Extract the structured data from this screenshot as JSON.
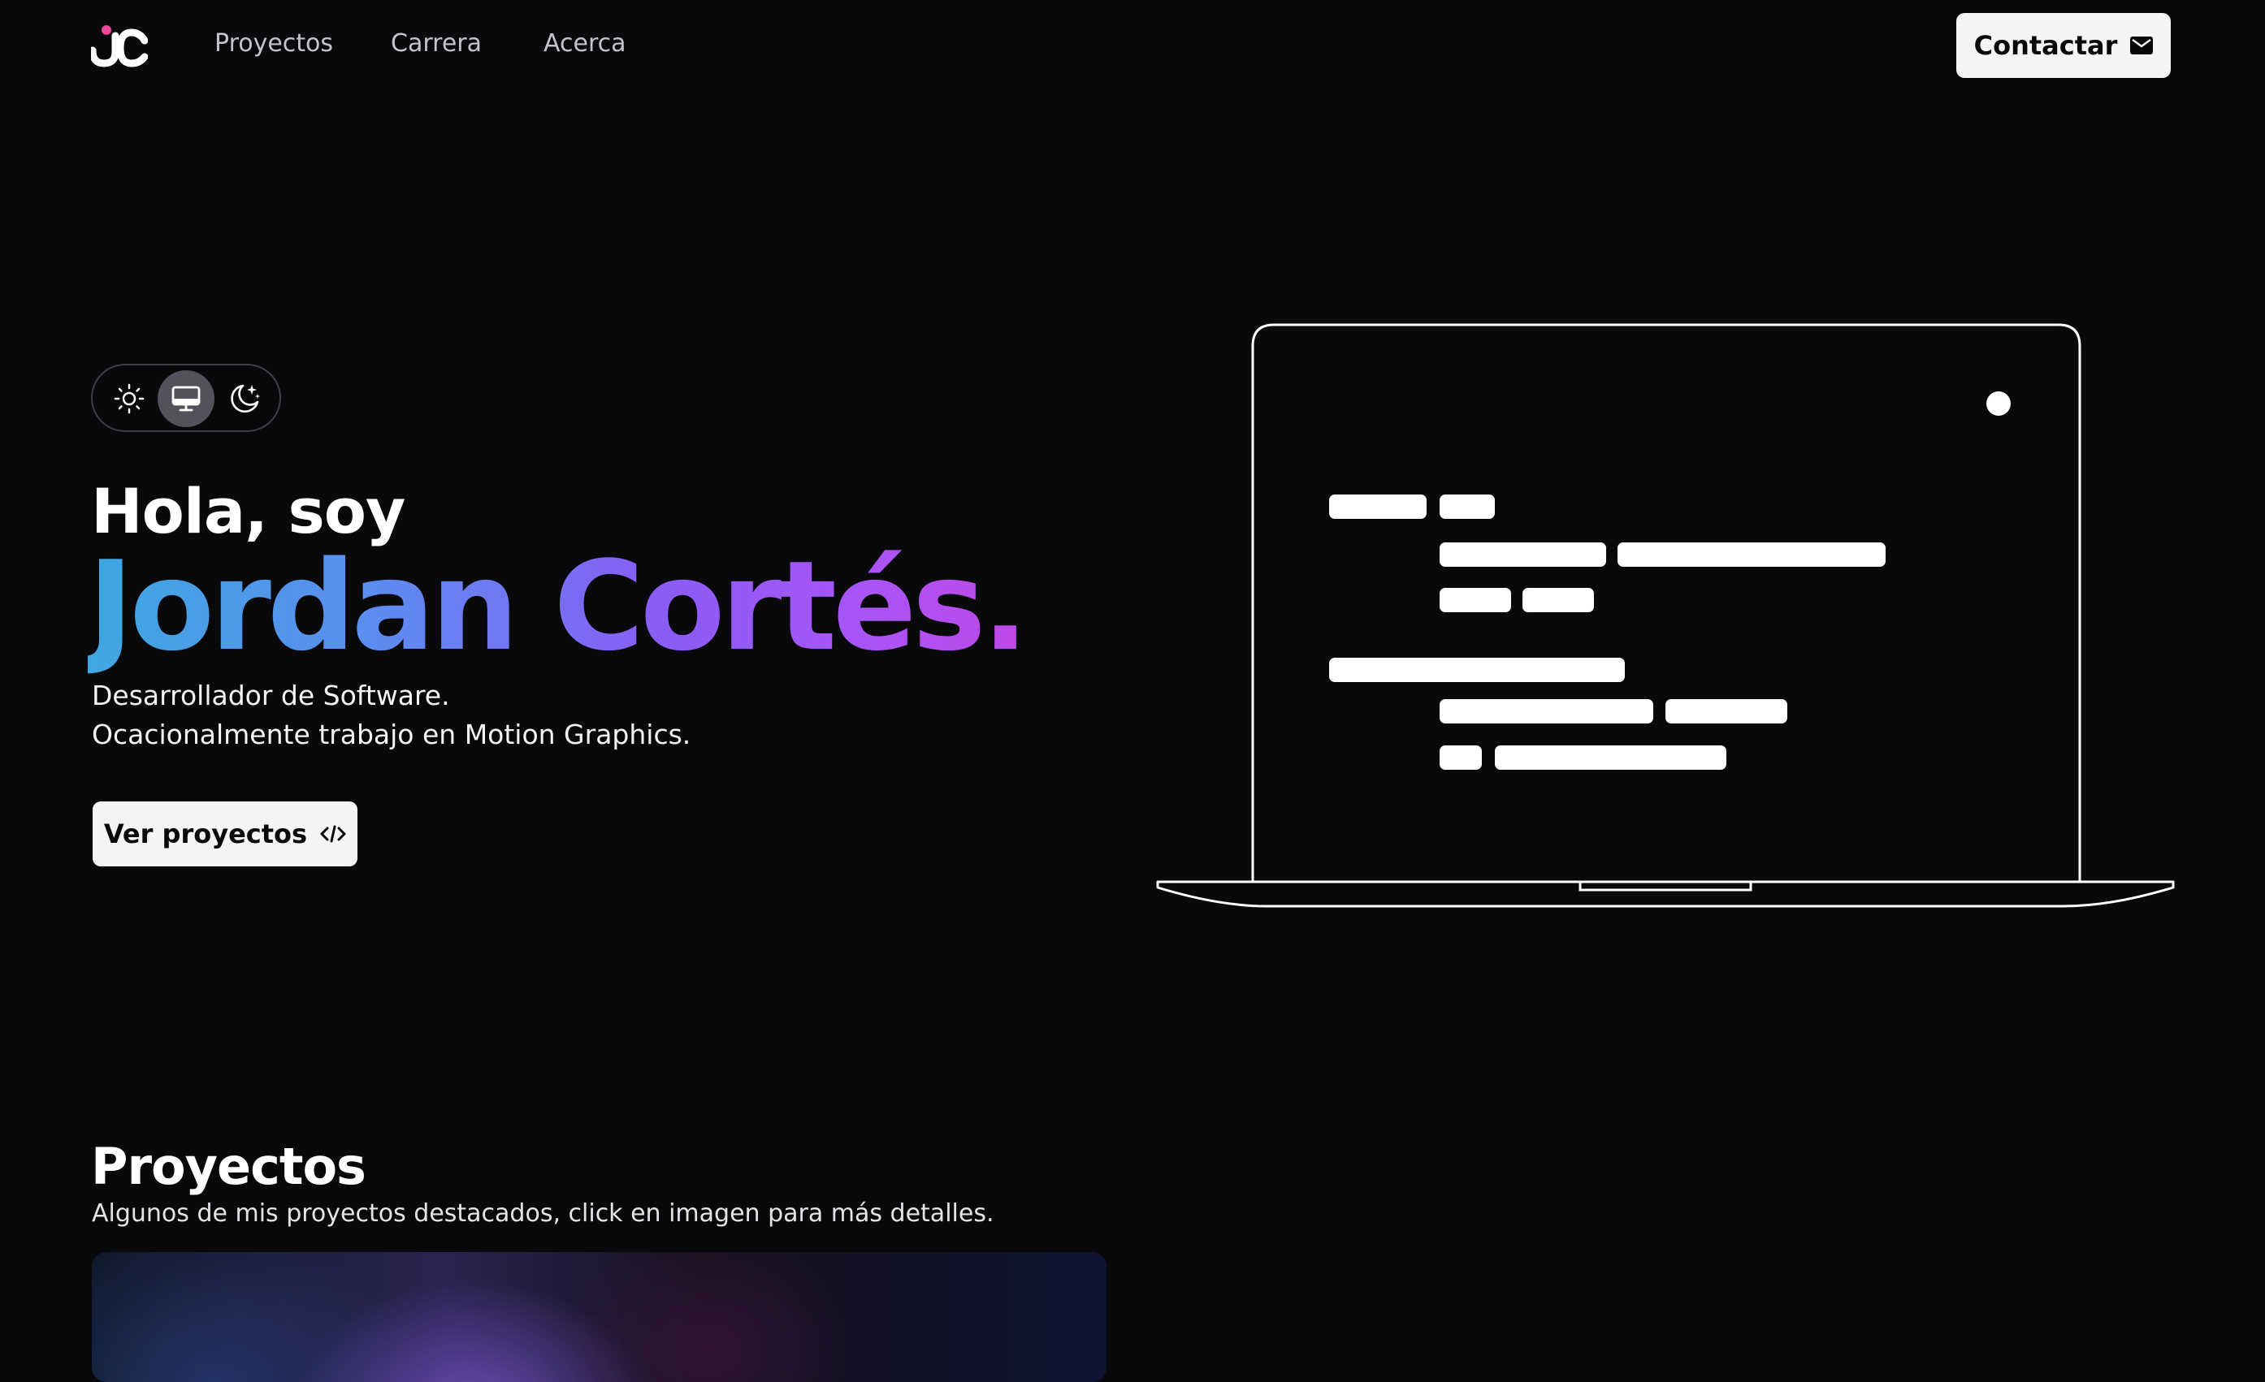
{
  "header": {
    "nav": [
      {
        "label": "Proyectos"
      },
      {
        "label": "Carrera"
      },
      {
        "label": "Acerca"
      }
    ],
    "contact_label": "Contactar"
  },
  "theme": {
    "options": [
      "sun-icon",
      "monitor-icon",
      "moon-stars-icon"
    ],
    "selected": "monitor-icon"
  },
  "hero": {
    "greeting": "Hola, soy",
    "name": "Jordan Cortés.",
    "tagline_1": "Desarrollador de Software.",
    "tagline_2": "Ocacionalmente trabajo en Motion Graphics.",
    "cta_label": "Ver proyectos"
  },
  "projects": {
    "title": "Proyectos",
    "subtitle": "Algunos de mis proyectos destacados, click en imagen para más detalles."
  },
  "colors": {
    "background": "#09090b",
    "accent_pink": "#ec4899",
    "name_gradient": [
      "#3fa8e0",
      "#8b5cf6",
      "#c048e8"
    ]
  }
}
